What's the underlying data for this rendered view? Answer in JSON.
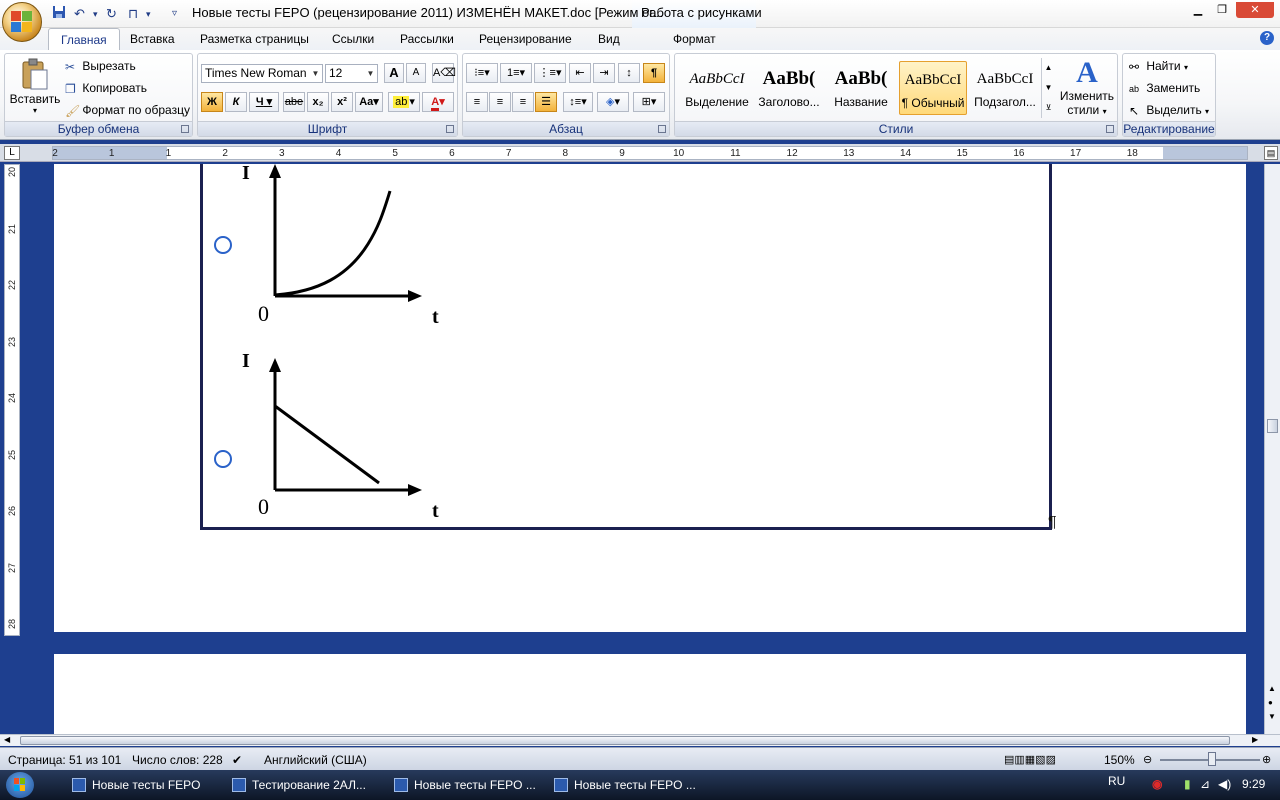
{
  "window": {
    "title": "Новые тесты FEPO (рецензирование 2011) ИЗМЕНЁН МАКЕТ.doc [Режим ог...",
    "contextual_tools": "Работа с рисунками",
    "minimize": "▁",
    "maximize": "❐",
    "close": "✕"
  },
  "tabs": {
    "home": "Главная",
    "insert": "Вставка",
    "page_layout": "Разметка страницы",
    "references": "Ссылки",
    "mailings": "Рассылки",
    "review": "Рецензирование",
    "view": "Вид",
    "format": "Формат",
    "help": "?"
  },
  "ribbon": {
    "clipboard": {
      "label": "Буфер обмена",
      "paste": "Вставить",
      "cut": "Вырезать",
      "copy": "Копировать",
      "format_painter": "Формат по образцу"
    },
    "font": {
      "label": "Шрифт",
      "font_name": "Times New Roman",
      "font_size": "12",
      "bold": "Ж",
      "italic": "К",
      "underline": "Ч",
      "strikethrough": "abe",
      "subscript": "x₂",
      "superscript": "x²",
      "change_case": "Aa",
      "grow": "A",
      "shrink": "A"
    },
    "paragraph": {
      "label": "Абзац",
      "show_marks": "¶"
    },
    "styles": {
      "label": "Стили",
      "items": [
        {
          "sample": "AaBbCcI",
          "name": "Выделение"
        },
        {
          "sample": "AaBb(",
          "name": "Заголово..."
        },
        {
          "sample": "AaBb(",
          "name": "Название"
        },
        {
          "sample": "AaBbCcI",
          "name": "¶ Обычный"
        },
        {
          "sample": "AaBbCcI",
          "name": "Подзагол..."
        }
      ],
      "change_styles_line1": "Изменить",
      "change_styles_line2": "стили"
    },
    "editing": {
      "label": "Редактирование",
      "find": "Найти",
      "replace": "Заменить",
      "select": "Выделить"
    }
  },
  "ruler": {
    "horizontal": [
      "2",
      "1",
      "1",
      "2",
      "3",
      "4",
      "5",
      "6",
      "7",
      "8",
      "9",
      "10",
      "11",
      "12",
      "13",
      "14",
      "15",
      "16",
      "17",
      "18"
    ],
    "vertical": [
      "20",
      "21",
      "22",
      "23",
      "24",
      "25",
      "26",
      "27",
      "28"
    ],
    "corner": "L"
  },
  "document": {
    "graph1": {
      "y_label": "I",
      "origin": "0",
      "x_label": "t"
    },
    "graph2": {
      "y_label": "I",
      "origin": "0",
      "x_label": "t"
    },
    "para_mark": "¶"
  },
  "status": {
    "page": "Страница: 51 из 101",
    "words": "Число слов: 228",
    "language": "Английский (США)",
    "zoom": "150%"
  },
  "taskbar": {
    "items": [
      "Новые тесты FEPO",
      "Тестирование 2АЛ...",
      "Новые тесты FEPO ...",
      "Новые тесты FEPO ..."
    ],
    "lang": "RU",
    "clock": "9:29"
  },
  "colors": {
    "accent": "#2a62c9",
    "doc_background": "#1e3f8f",
    "frame": "#1b2050"
  }
}
